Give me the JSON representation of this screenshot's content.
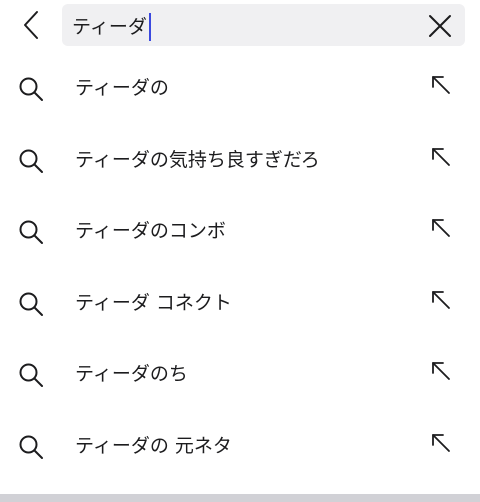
{
  "search": {
    "query": "ティーダ"
  },
  "icons": {
    "back": "chevron-left-icon",
    "clear": "close-icon",
    "suggestion": "search-icon",
    "fill_query": "arrow-up-left-icon"
  },
  "colors": {
    "caret": "#3b49df",
    "field_background": "#f0f0f2"
  },
  "suggestions": [
    {
      "text": "ティーダの"
    },
    {
      "text": "ティーダの気持ち良すぎだろ"
    },
    {
      "text": "ティーダのコンボ"
    },
    {
      "text": "ティーダ コネクト"
    },
    {
      "text": "ティーダのち"
    },
    {
      "text": "ティーダの 元ネタ"
    }
  ]
}
